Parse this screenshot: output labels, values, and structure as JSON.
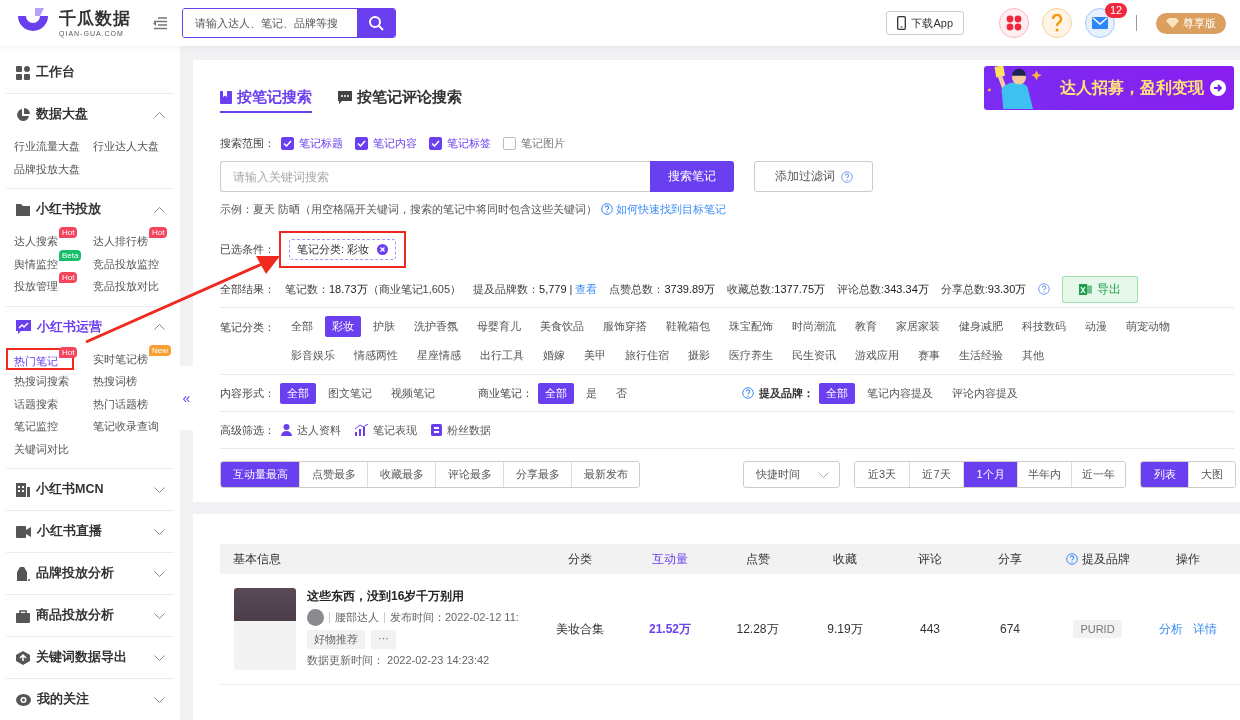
{
  "brand": {
    "name": "千瓜数据",
    "domain": "QIAN-GUA.COM"
  },
  "top_search": {
    "placeholder": "请输入达人、笔记、品牌等搜"
  },
  "download_button": "下载App",
  "message_badge": "12",
  "vip_button": "尊享版",
  "sidebar": {
    "collapse": "«",
    "sections": [
      {
        "kind": "link",
        "title": "工作台"
      },
      {
        "kind": "group",
        "title": "数据大盘",
        "expanded": true,
        "active": false,
        "items": [
          {
            "label": "行业流量大盘",
            "selected": false,
            "marked": false
          },
          {
            "label": "行业达人大盘",
            "selected": false,
            "marked": false
          },
          {
            "label": "品牌投放大盘",
            "selected": false,
            "marked": false
          }
        ]
      },
      {
        "kind": "group",
        "title": "小红书投放",
        "expanded": true,
        "active": false,
        "items": [
          {
            "label": "达人搜索",
            "selected": false,
            "marked": false,
            "badge": {
              "text": "Hot",
              "color": "#f5455c"
            }
          },
          {
            "label": "达人排行榜",
            "selected": false,
            "marked": false,
            "badge": {
              "text": "Hot",
              "color": "#f5455c"
            }
          },
          {
            "label": "舆情监控",
            "selected": false,
            "marked": false,
            "badge": {
              "text": "Beta",
              "color": "#19be6b"
            }
          },
          {
            "label": "竞品投放监控",
            "selected": false,
            "marked": false
          },
          {
            "label": "投放管理",
            "selected": false,
            "marked": false,
            "badge": {
              "text": "Hot",
              "color": "#f5455c"
            }
          },
          {
            "label": "竞品投放对比",
            "selected": false,
            "marked": false
          }
        ]
      },
      {
        "kind": "group",
        "title": "小红书运营",
        "expanded": true,
        "active": true,
        "items": [
          {
            "label": "热门笔记",
            "selected": true,
            "marked": true,
            "badge": {
              "text": "Hot",
              "color": "#f5455c"
            }
          },
          {
            "label": "实时笔记榜",
            "selected": false,
            "marked": false,
            "badge": {
              "text": "New",
              "color": "#f7a035"
            }
          },
          {
            "label": "热搜词搜索",
            "selected": false,
            "marked": false
          },
          {
            "label": "热搜词榜",
            "selected": false,
            "marked": false
          },
          {
            "label": "话题搜索",
            "selected": false,
            "marked": false
          },
          {
            "label": "热门话题榜",
            "selected": false,
            "marked": false
          },
          {
            "label": "笔记监控",
            "selected": false,
            "marked": false
          },
          {
            "label": "笔记收录查询",
            "selected": false,
            "marked": false
          },
          {
            "label": "关键词对比",
            "selected": false,
            "marked": false
          }
        ]
      },
      {
        "kind": "group",
        "title": "小红书MCN",
        "expanded": false,
        "active": false
      },
      {
        "kind": "group",
        "title": "小红书直播",
        "expanded": false,
        "active": false
      },
      {
        "kind": "group",
        "title": "品牌投放分析",
        "expanded": false,
        "active": false
      },
      {
        "kind": "group",
        "title": "商品投放分析",
        "expanded": false,
        "active": false
      },
      {
        "kind": "group",
        "title": "关键词数据导出",
        "expanded": false,
        "active": false
      },
      {
        "kind": "group",
        "title": "我的关注",
        "expanded": false,
        "active": false
      }
    ]
  },
  "tabs": [
    {
      "label": "按笔记搜索",
      "selected": true
    },
    {
      "label": "按笔记评论搜索",
      "selected": false
    }
  ],
  "banner": {
    "text": "达人招募，盈利变现"
  },
  "scope": {
    "label": "搜索范围：",
    "options": [
      {
        "label": "笔记标题",
        "checked": true
      },
      {
        "label": "笔记内容",
        "checked": true
      },
      {
        "label": "笔记标签",
        "checked": true
      },
      {
        "label": "笔记图片",
        "checked": false
      }
    ]
  },
  "keyword_search": {
    "placeholder": "请输入关键词搜索",
    "button": "搜索笔记",
    "filter_button": "添加过滤词"
  },
  "example": {
    "text": "示例：夏天 防晒（用空格隔开关键词，搜索的笔记中将同时包含这些关键词）",
    "link": "如何快速找到目标笔记"
  },
  "selected_conditions": {
    "label": "已选条件：",
    "chips": [
      {
        "text": "笔记分类: 彩妆",
        "marked": true
      }
    ]
  },
  "results": {
    "label": "全部结果：",
    "export_button": "导出",
    "stats": [
      {
        "label": "笔记数：",
        "value": "18.73万",
        "note": "（商业笔记1,605）"
      },
      {
        "label": "提及品牌数：",
        "value": "5,779",
        "separator": "|",
        "link": "查看"
      },
      {
        "label": "点赞总数：",
        "value": "3739.89万"
      },
      {
        "label": "收藏总数: ",
        "value": "1377.75万"
      },
      {
        "label": "评论总数: ",
        "value": "343.34万"
      },
      {
        "label": "分享总数: ",
        "value": "93.30万"
      }
    ]
  },
  "category_filter": {
    "label": "笔记分类：",
    "options": [
      {
        "label": "全部",
        "selected": false
      },
      {
        "label": "彩妆",
        "selected": true
      },
      {
        "label": "护肤",
        "selected": false
      },
      {
        "label": "洗护香氛",
        "selected": false
      },
      {
        "label": "母婴育儿",
        "selected": false
      },
      {
        "label": "美食饮品",
        "selected": false
      },
      {
        "label": "服饰穿搭",
        "selected": false
      },
      {
        "label": "鞋靴箱包",
        "selected": false
      },
      {
        "label": "珠宝配饰",
        "selected": false
      },
      {
        "label": "时尚潮流",
        "selected": false
      },
      {
        "label": "教育",
        "selected": false
      },
      {
        "label": "家居家装",
        "selected": false
      },
      {
        "label": "健身减肥",
        "selected": false
      },
      {
        "label": "科技数码",
        "selected": false
      },
      {
        "label": "动漫",
        "selected": false
      },
      {
        "label": "萌宠动物",
        "selected": false
      },
      {
        "label": "影音娱乐",
        "selected": false
      },
      {
        "label": "情感两性",
        "selected": false
      },
      {
        "label": "星座情感",
        "selected": false
      },
      {
        "label": "出行工具",
        "selected": false
      },
      {
        "label": "婚嫁",
        "selected": false
      },
      {
        "label": "美甲",
        "selected": false
      },
      {
        "label": "旅行住宿",
        "selected": false
      },
      {
        "label": "摄影",
        "selected": false
      },
      {
        "label": "医疗养生",
        "selected": false
      },
      {
        "label": "民生资讯",
        "selected": false
      },
      {
        "label": "游戏应用",
        "selected": false
      },
      {
        "label": "赛事",
        "selected": false
      },
      {
        "label": "生活经验",
        "selected": false
      },
      {
        "label": "其他",
        "selected": false
      }
    ]
  },
  "option_filters": [
    {
      "label": "内容形式：",
      "help": false,
      "options": [
        {
          "label": "全部",
          "selected": true
        },
        {
          "label": "图文笔记",
          "selected": false
        },
        {
          "label": "视频笔记",
          "selected": false
        }
      ]
    },
    {
      "label": "商业笔记：",
      "help": false,
      "options": [
        {
          "label": "全部",
          "selected": true
        },
        {
          "label": "是",
          "selected": false
        },
        {
          "label": "否",
          "selected": false
        }
      ]
    },
    {
      "label": "提及品牌：",
      "help": true,
      "options": [
        {
          "label": "全部",
          "selected": true
        },
        {
          "label": "笔记内容提及",
          "selected": false
        },
        {
          "label": "评论内容提及",
          "selected": false
        }
      ]
    }
  ],
  "advanced_filter": {
    "label": "高级筛选：",
    "items": [
      "达人资料",
      "笔记表现",
      "粉丝数据"
    ]
  },
  "sort_tabs": [
    {
      "label": "互动量最高",
      "selected": true
    },
    {
      "label": "点赞最多",
      "selected": false
    },
    {
      "label": "收藏最多",
      "selected": false
    },
    {
      "label": "评论最多",
      "selected": false
    },
    {
      "label": "分享最多",
      "selected": false
    },
    {
      "label": "最新发布",
      "selected": false
    }
  ],
  "quick_time": {
    "placeholder": "快捷时间"
  },
  "time_ranges": [
    {
      "label": "近3天",
      "selected": false
    },
    {
      "label": "近7天",
      "selected": false
    },
    {
      "label": "1个月",
      "selected": true
    },
    {
      "label": "半年内",
      "selected": false
    },
    {
      "label": "近一年",
      "selected": false
    }
  ],
  "view_modes": [
    {
      "label": "列表",
      "selected": true
    },
    {
      "label": "大图",
      "selected": false
    }
  ],
  "table": {
    "columns": [
      {
        "label": "基本信息",
        "sorted": false,
        "help": false
      },
      {
        "label": "分类",
        "sorted": false,
        "help": false
      },
      {
        "label": "互动量",
        "sorted": true,
        "help": false
      },
      {
        "label": "点赞",
        "sorted": false,
        "help": false
      },
      {
        "label": "收藏",
        "sorted": false,
        "help": false
      },
      {
        "label": "评论",
        "sorted": false,
        "help": false
      },
      {
        "label": "分享",
        "sorted": false,
        "help": false
      },
      {
        "label": "提及品牌",
        "sorted": false,
        "help": true
      },
      {
        "label": "操作",
        "sorted": false,
        "help": false
      }
    ],
    "rows": [
      {
        "title": "这些东西，没到16岁千万别用",
        "author_level": "腰部达人",
        "published": "发布时间：2022-02-12 11:",
        "tags": [
          "好物推荐",
          "···"
        ],
        "updated": "数据更新时间：  2022-02-23 14:23:42",
        "category": "美妆合集",
        "interactions": "21.52万",
        "likes": "12.28万",
        "favorites": "9.19万",
        "comments": "443",
        "shares": "674",
        "brand": "PURID",
        "actions": [
          "分析",
          "详情"
        ]
      }
    ]
  }
}
